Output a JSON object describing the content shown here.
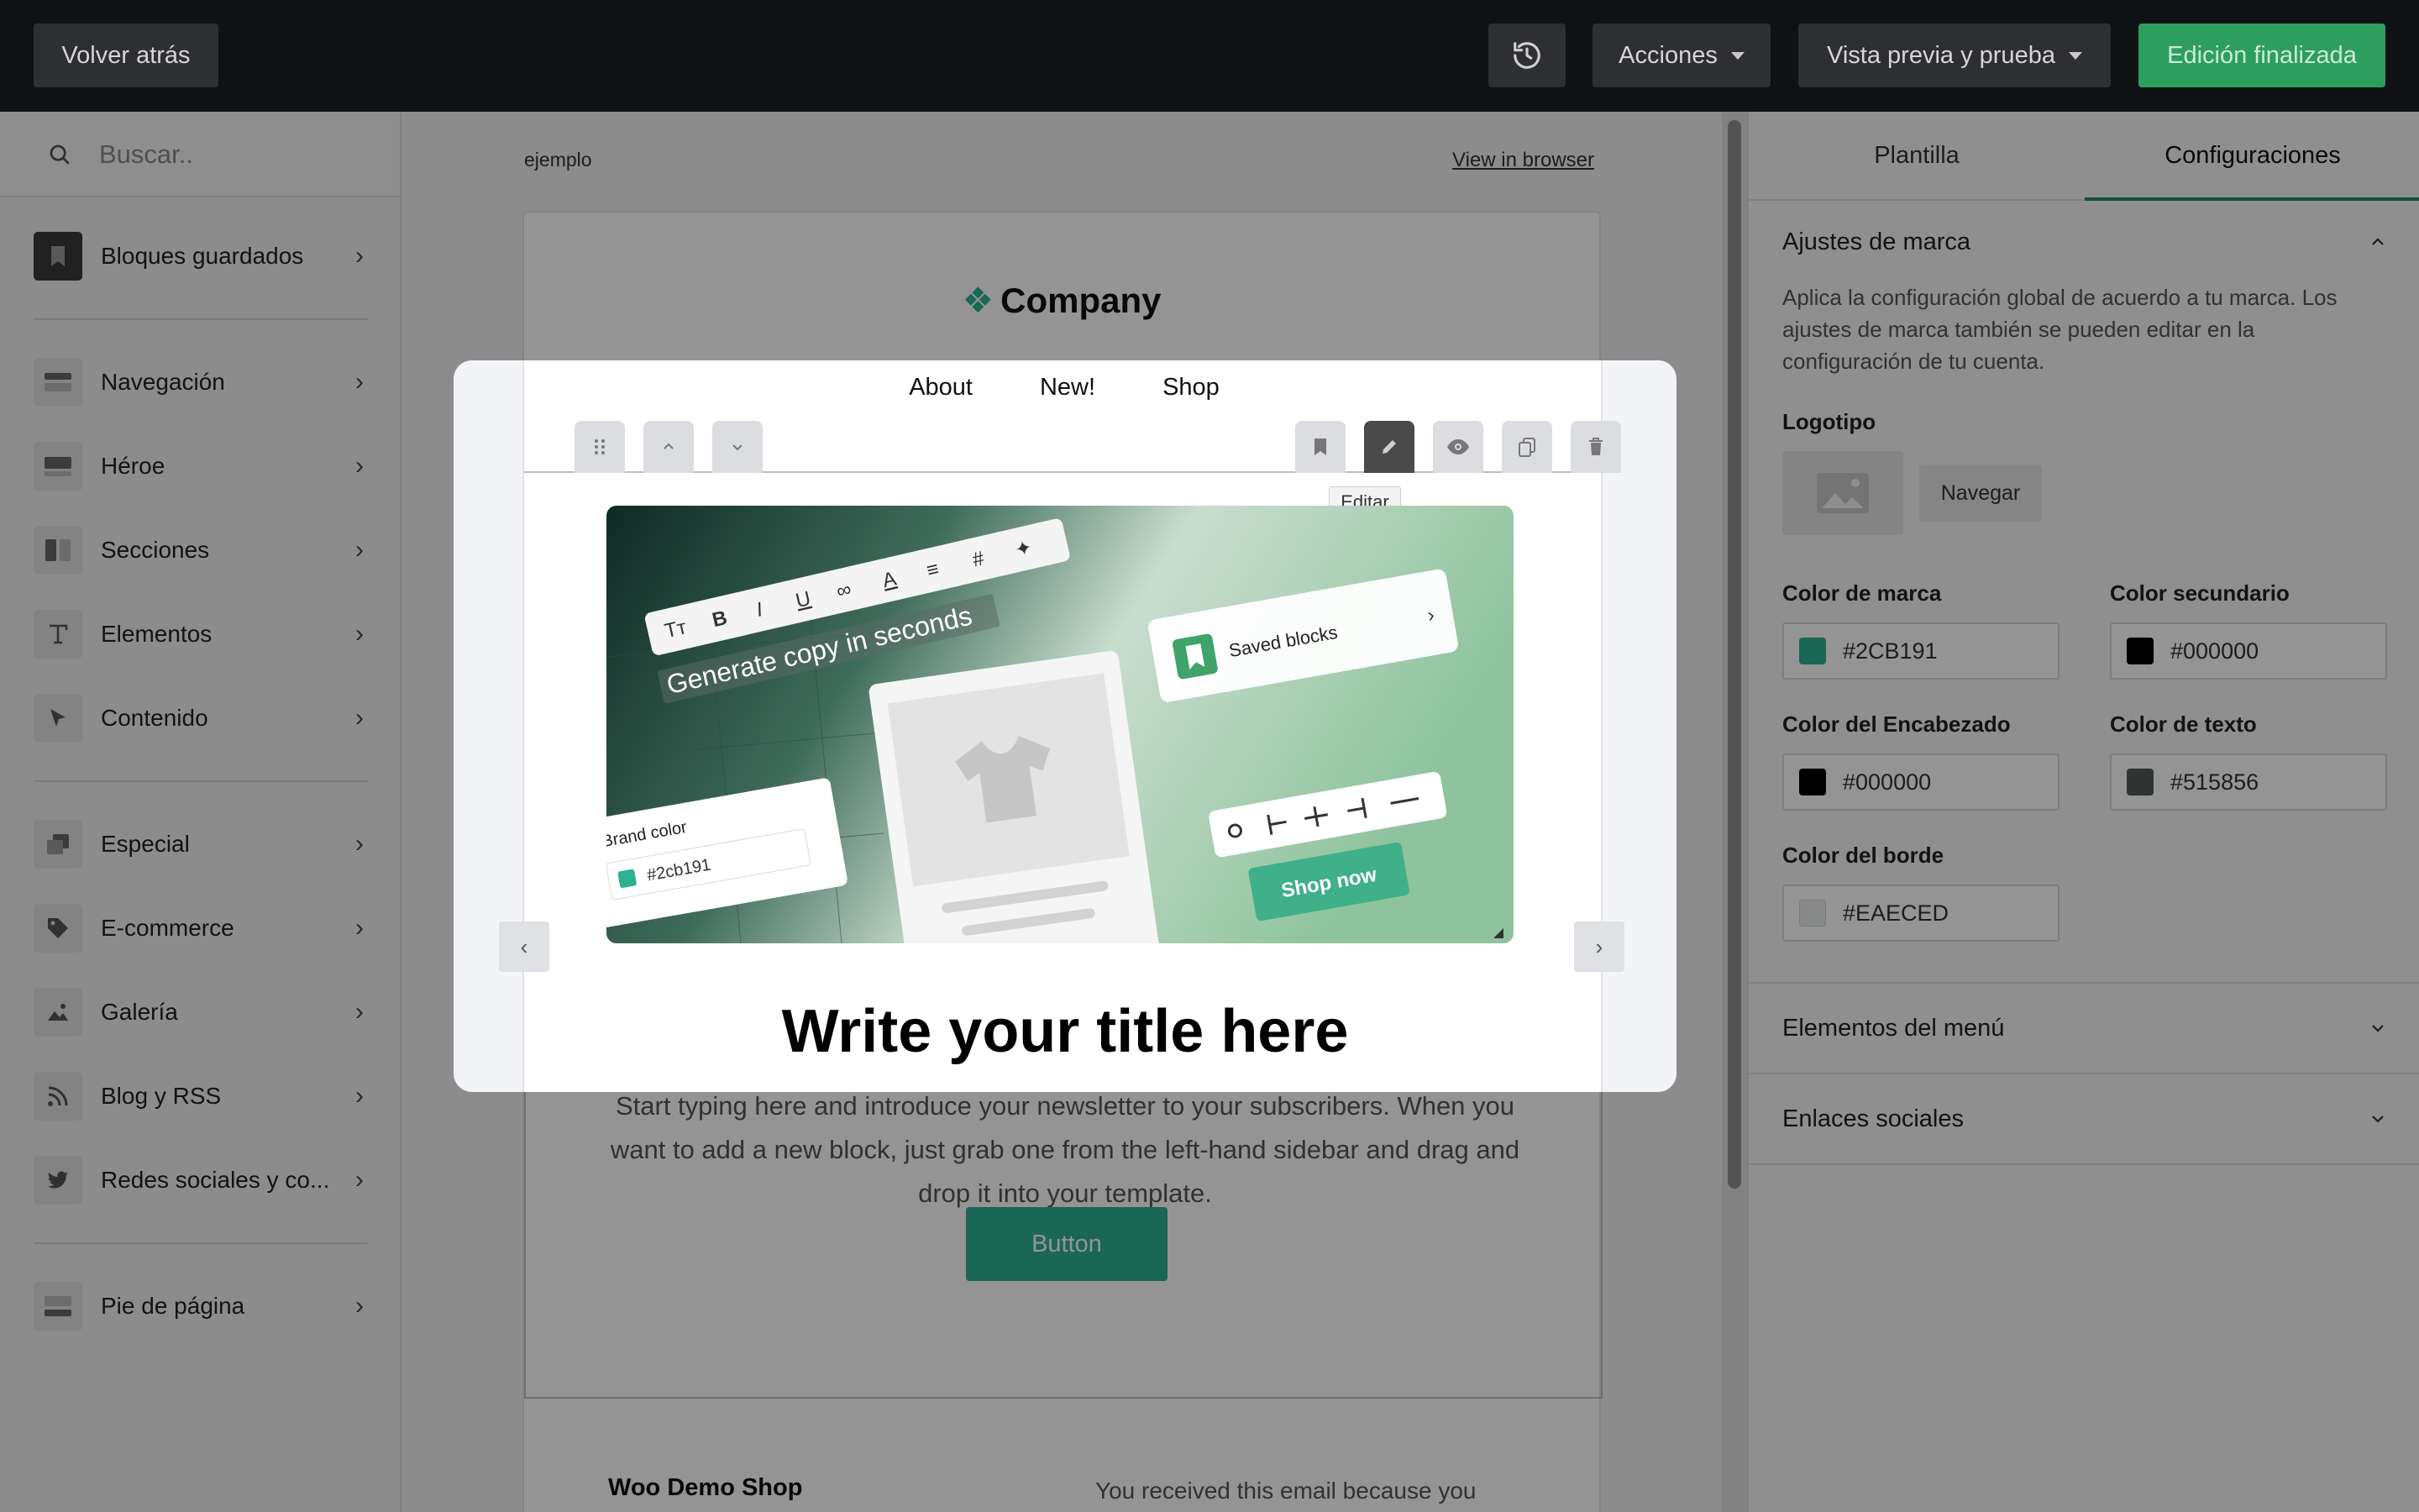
{
  "topbar": {
    "back_label": "Volver atrás",
    "actions_label": "Acciones",
    "preview_label": "Vista previa y prueba",
    "done_label": "Edición finalizada"
  },
  "sidebar": {
    "search_placeholder": "Buscar..",
    "items": [
      {
        "label": "Bloques guardados",
        "icon": "bookmark-icon"
      },
      {
        "label": "Navegación",
        "icon": "navigation-icon"
      },
      {
        "label": "Héroe",
        "icon": "hero-icon"
      },
      {
        "label": "Secciones",
        "icon": "sections-icon"
      },
      {
        "label": "Elementos",
        "icon": "text-icon"
      },
      {
        "label": "Contenido",
        "icon": "cursor-icon"
      },
      {
        "label": "Especial",
        "icon": "special-icon"
      },
      {
        "label": "E-commerce",
        "icon": "tag-icon"
      },
      {
        "label": "Galería",
        "icon": "image-icon"
      },
      {
        "label": "Blog y RSS",
        "icon": "rss-icon"
      },
      {
        "label": "Redes sociales y co...",
        "icon": "twitter-icon"
      },
      {
        "label": "Pie de página",
        "icon": "footer-icon"
      }
    ]
  },
  "canvas": {
    "preheader": "ejemplo",
    "view_in_browser": "View in browser",
    "company": "Company",
    "nav": [
      "About",
      "New!",
      "Shop"
    ],
    "body_text": "Start typing here and introduce your newsletter to your subscribers. When you want to add a new block, just grab one from the left-hand sidebar and drag and drop it into your template.",
    "button_label": "Button",
    "footer_shop": "Woo Demo Shop",
    "footer_note": "You received this email because you"
  },
  "modal": {
    "tooltip": "Editar",
    "title": "Write your title here",
    "hero": {
      "headline": "Generate copy in seconds",
      "saved_blocks": "Saved blocks",
      "brand_color_label": "Brand color",
      "brand_color_value": "#2cb191",
      "shop_now": "Shop now"
    }
  },
  "panel": {
    "tabs": [
      "Plantilla",
      "Configuraciones"
    ],
    "brand_section": {
      "title": "Ajustes de marca",
      "description": "Aplica la configuración global de acuerdo a tu marca. Los ajustes de marca también se pueden editar en la configuración de tu cuenta.",
      "logo_label": "Logotipo",
      "browse_label": "Navegar",
      "brand_color_label": "Color de marca",
      "brand_color": "#2CB191",
      "secondary_color_label": "Color secundario",
      "secondary_color": "#000000",
      "heading_color_label": "Color del Encabezado",
      "heading_color": "#000000",
      "text_color_label": "Color de texto",
      "text_color": "#515856",
      "border_color_label": "Color del borde",
      "border_color": "#EAECED"
    },
    "menu_section": "Elementos del menú",
    "social_section": "Enlaces sociales"
  }
}
